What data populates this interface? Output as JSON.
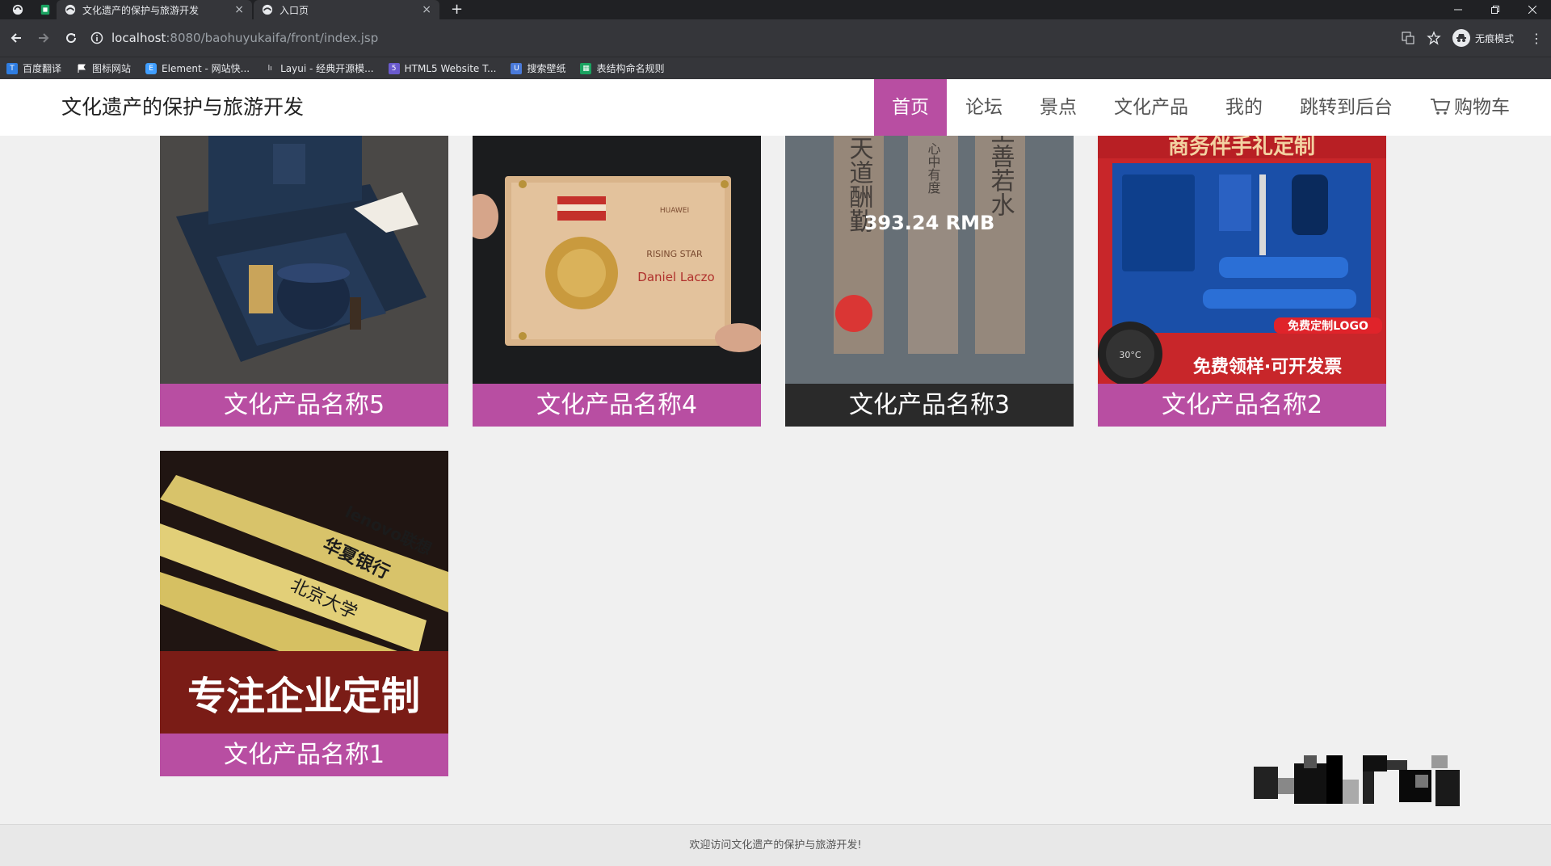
{
  "browser": {
    "tabs": [
      {
        "title": "文化遗产的保护与旅游开发",
        "close": "×"
      },
      {
        "title": "入口页",
        "close": "×"
      }
    ],
    "new_tab": "+",
    "url_host": "localhost",
    "url_path": ":8080/baohuyukaifa/front/index.jsp",
    "profile_label": "无痕模式",
    "bookmarks": [
      {
        "label": "百度翻译",
        "color": "#2f7de1"
      },
      {
        "label": "图标网站",
        "color": "#ffffff"
      },
      {
        "label": "Element - 网站快...",
        "color": "#409eff"
      },
      {
        "label": "Layui - 经典开源模...",
        "color": "#ffffff"
      },
      {
        "label": "HTML5 Website T...",
        "color": "#6a5acd"
      },
      {
        "label": "搜索壁纸",
        "color": "#4a7ad9"
      },
      {
        "label": "表结构命名规则",
        "color": "#1aa260"
      }
    ]
  },
  "site": {
    "title": "文化遗产的保护与旅游开发",
    "nav": [
      "首页",
      "论坛",
      "景点",
      "文化产品",
      "我的",
      "跳转到后台",
      "购物车"
    ],
    "active_nav": "首页",
    "accent_color": "#b84ea2"
  },
  "products": [
    {
      "name": "文化产品名称5"
    },
    {
      "name": "文化产品名称4",
      "image_text": [
        "HUAWEI",
        "RISING STAR",
        "Daniel Laczo"
      ]
    },
    {
      "name": "文化产品名称3",
      "price": "393.24 RMB",
      "image_text": [
        "天道酬勤",
        "心中有度",
        "上善若水"
      ]
    },
    {
      "name": "文化产品名称2",
      "image_text": [
        "商务伴手礼定制",
        "免费定制LOGO",
        "免费领样·可开发票",
        "30°C"
      ]
    },
    {
      "name": "文化产品名称1",
      "image_text": [
        "lenovo联想",
        "华夏银行",
        "北京大学",
        "专注企业定制"
      ]
    }
  ],
  "footer": "欢迎访问文化遗产的保护与旅游开发!"
}
